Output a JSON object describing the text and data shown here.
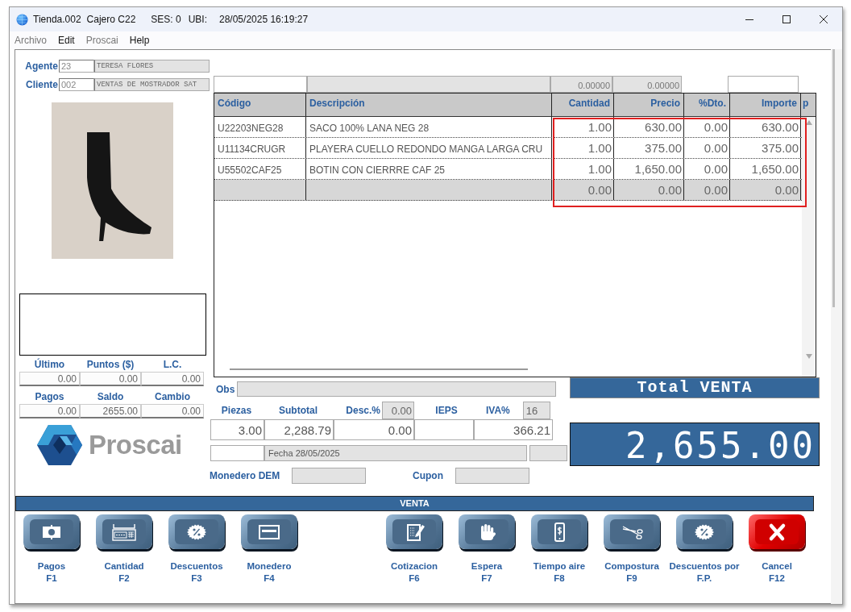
{
  "window": {
    "title": "Tienda.002",
    "cashier": "Cajero C22",
    "session": "SES: 0",
    "location": "UBI:",
    "datetime": "28/05/2025 16:19:27"
  },
  "menu": [
    {
      "label": "Archivo",
      "disabled": true
    },
    {
      "label": "Edit",
      "disabled": false
    },
    {
      "label": "Proscai",
      "disabled": true
    },
    {
      "label": "Help",
      "disabled": false
    }
  ],
  "agent": {
    "label": "Agente",
    "code": "23",
    "name": "TERESA FLORES"
  },
  "client": {
    "label": "Cliente",
    "code": "002",
    "name": "VENTAS DE MOSTRADOR SAT"
  },
  "stats": [
    {
      "label": "Último",
      "value": "0.00"
    },
    {
      "label": "Puntos ($)",
      "value": "0.00"
    },
    {
      "label": "L.C.",
      "value": "0.00"
    },
    {
      "label": "Pagos",
      "value": "0.00"
    },
    {
      "label": "Saldo",
      "value": "2655.00"
    },
    {
      "label": "Cambio",
      "value": "0.00"
    }
  ],
  "logo": {
    "text": "Proscai"
  },
  "top_fields": [
    "0.00000",
    "0.00000"
  ],
  "table": {
    "highlighted": true,
    "columns": [
      "Código",
      "Descripción",
      "Cantidad",
      "Precio",
      "%Dto.",
      "Importe",
      "p"
    ],
    "rows": [
      {
        "code": "U22203NEG28",
        "description": "SACO 100% LANA NEG 28",
        "quantity": "1.00",
        "price": "630.00",
        "discount": "0.00",
        "amount": "630.00",
        "selected": false
      },
      {
        "code": "U11134CRUGR",
        "description": "PLAYERA CUELLO REDONDO MANGA LARGA CRU",
        "quantity": "1.00",
        "price": "375.00",
        "discount": "0.00",
        "amount": "375.00",
        "selected": false
      },
      {
        "code": "U55502CAF25",
        "description": "BOTIN  CON CIERRRE CAF 25",
        "quantity": "1.00",
        "price": "1,650.00",
        "discount": "0.00",
        "amount": "1,650.00",
        "selected": false
      },
      {
        "quantity": "0.00",
        "price": "0.00",
        "discount": "0.00",
        "amount": "0.00",
        "selected": true
      }
    ]
  },
  "obs": {
    "label": "Obs"
  },
  "summary": {
    "pieces": {
      "label": "Piezas",
      "value": "3.00"
    },
    "subtotal": {
      "label": "Subtotal",
      "value": "2,288.79"
    },
    "discount": {
      "label": "Desc.%",
      "rate": "0.00",
      "value": "0.00"
    },
    "ieps": {
      "label": "IEPS"
    },
    "iva": {
      "label": "IVA%",
      "rate": "16",
      "value": "366.21"
    }
  },
  "date_field": "Fecha 28/05/2025",
  "monedero": {
    "label": "Monedero DEM"
  },
  "cupon": {
    "label": "Cupon"
  },
  "total": {
    "title": "Total VENTA",
    "amount": "2,655.00"
  },
  "section": "VENTA",
  "actions": {
    "primary": [
      {
        "kind": "payment",
        "label": "Pagos",
        "key": "F1"
      },
      {
        "kind": "quantity",
        "label": "Cantidad",
        "key": "F2"
      },
      {
        "kind": "discount",
        "label": "Descuentos",
        "key": "F3"
      },
      {
        "kind": "wallet",
        "label": "Monedero",
        "key": "F4"
      }
    ],
    "secondary": [
      {
        "kind": "quote",
        "label": "Cotizacion",
        "key": "F6"
      },
      {
        "kind": "hold",
        "label": "Espera",
        "key": "F7"
      },
      {
        "kind": "airtime",
        "label": "Tiempo aire",
        "key": "F8"
      },
      {
        "kind": "tailoring",
        "label": "Compostura",
        "key": "F9"
      },
      {
        "kind": "discount",
        "label": "Descuentos por",
        "key": "F.P."
      },
      {
        "kind": "cancel",
        "label": "Cancel",
        "key": "F12"
      }
    ]
  }
}
